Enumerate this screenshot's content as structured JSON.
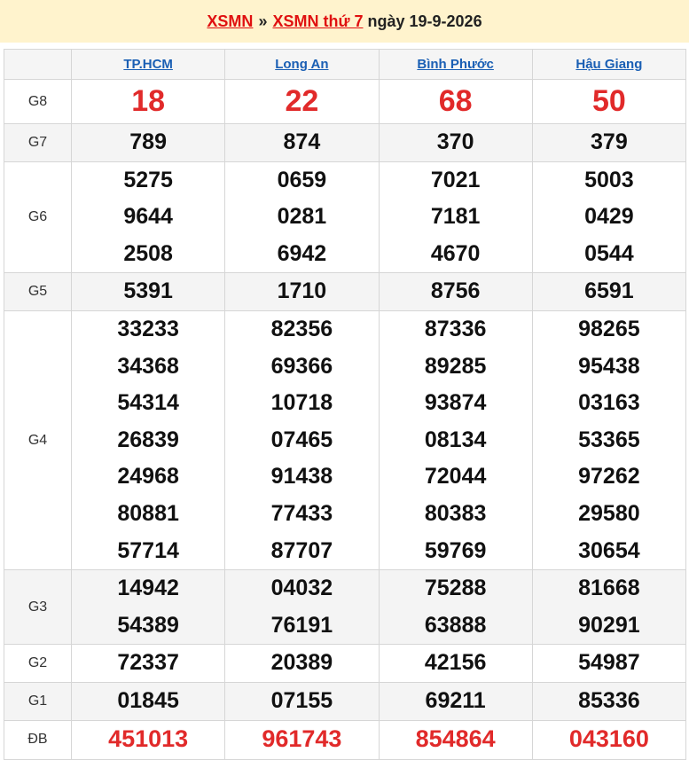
{
  "header": {
    "link1": "XSMN",
    "separator": "»",
    "link2": "XSMN thứ 7",
    "date": "ngày 19-9-2026"
  },
  "stations": [
    "TP.HCM",
    "Long An",
    "Bình Phước",
    "Hậu Giang"
  ],
  "colors": {
    "accent": "#e01010",
    "link": "#1a5fb4",
    "header_bg": "#fff3cd",
    "row_alt": "#f4f4f4"
  },
  "prizes": [
    {
      "label": "G8",
      "values": [
        [
          "18"
        ],
        [
          "22"
        ],
        [
          "68"
        ],
        [
          "50"
        ]
      ]
    },
    {
      "label": "G7",
      "values": [
        [
          "789"
        ],
        [
          "874"
        ],
        [
          "370"
        ],
        [
          "379"
        ]
      ]
    },
    {
      "label": "G6",
      "values": [
        [
          "5275",
          "9644",
          "2508"
        ],
        [
          "0659",
          "0281",
          "6942"
        ],
        [
          "7021",
          "7181",
          "4670"
        ],
        [
          "5003",
          "0429",
          "0544"
        ]
      ]
    },
    {
      "label": "G5",
      "values": [
        [
          "5391"
        ],
        [
          "1710"
        ],
        [
          "8756"
        ],
        [
          "6591"
        ]
      ]
    },
    {
      "label": "G4",
      "values": [
        [
          "33233",
          "34368",
          "54314",
          "26839",
          "24968",
          "80881",
          "57714"
        ],
        [
          "82356",
          "69366",
          "10718",
          "07465",
          "91438",
          "77433",
          "87707"
        ],
        [
          "87336",
          "89285",
          "93874",
          "08134",
          "72044",
          "80383",
          "59769"
        ],
        [
          "98265",
          "95438",
          "03163",
          "53365",
          "97262",
          "29580",
          "30654"
        ]
      ]
    },
    {
      "label": "G3",
      "values": [
        [
          "14942",
          "54389"
        ],
        [
          "04032",
          "76191"
        ],
        [
          "75288",
          "63888"
        ],
        [
          "81668",
          "90291"
        ]
      ]
    },
    {
      "label": "G2",
      "values": [
        [
          "72337"
        ],
        [
          "20389"
        ],
        [
          "42156"
        ],
        [
          "54987"
        ]
      ]
    },
    {
      "label": "G1",
      "values": [
        [
          "01845"
        ],
        [
          "07155"
        ],
        [
          "69211"
        ],
        [
          "85336"
        ]
      ]
    },
    {
      "label": "ĐB",
      "values": [
        [
          "451013"
        ],
        [
          "961743"
        ],
        [
          "854864"
        ],
        [
          "043160"
        ]
      ]
    }
  ]
}
